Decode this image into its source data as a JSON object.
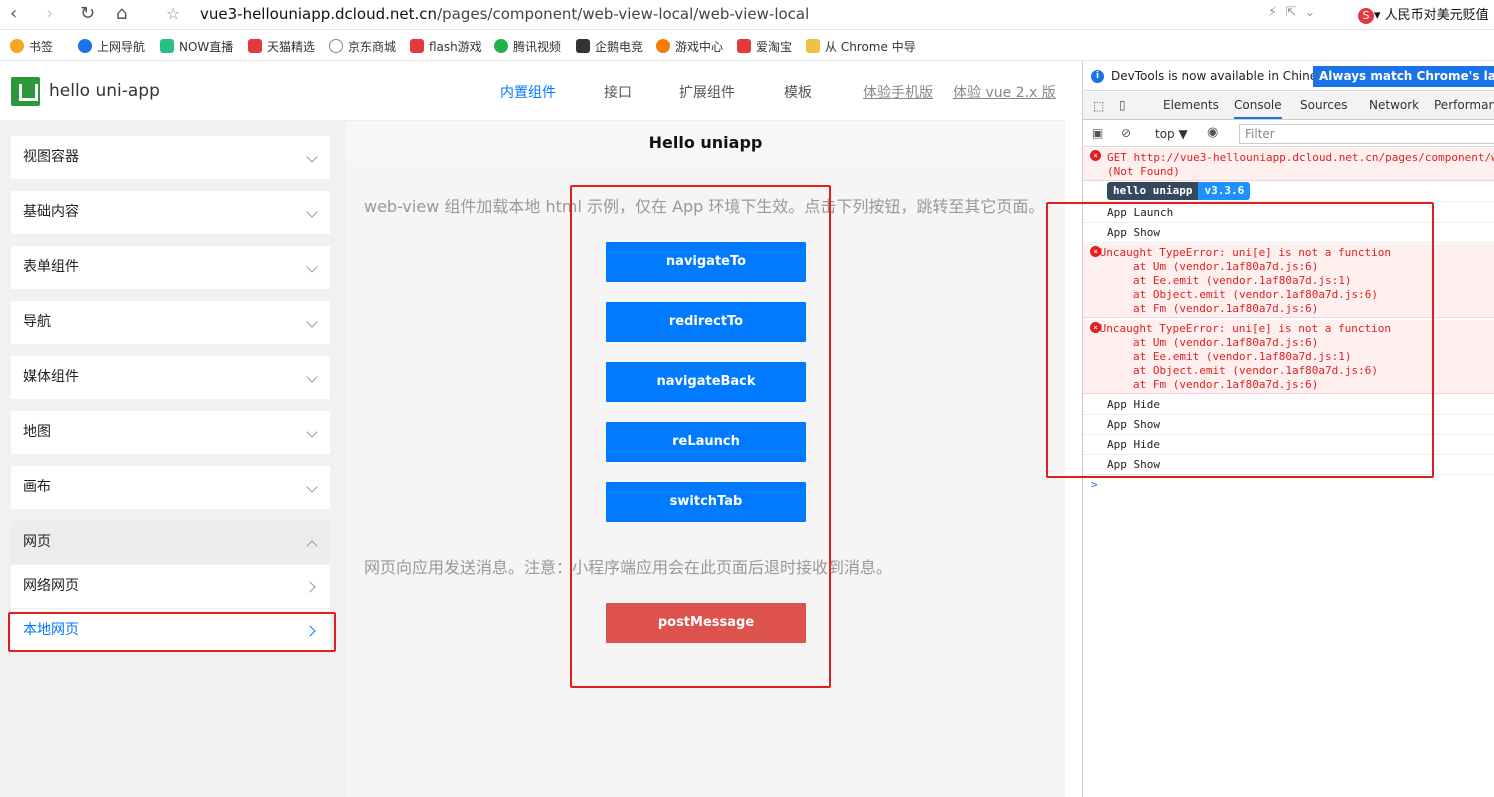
{
  "browser": {
    "url_host": "vue3-hellouniapp.dcloud.net.cn",
    "url_path": "/pages/component/web-view-local/web-view-local",
    "extension_text": "人民币对美元贬值"
  },
  "bookmarks": [
    {
      "label": "书签",
      "color": "#f5a623"
    },
    {
      "label": "上网导航",
      "color": "#1a73e8"
    },
    {
      "label": "NOW直播",
      "color": "#25c286"
    },
    {
      "label": "天猫精选",
      "color": "#e4393c"
    },
    {
      "label": "京东商城",
      "color": "#888888"
    },
    {
      "label": "flash游戏",
      "color": "#e4393c"
    },
    {
      "label": "腾讯视频",
      "color": "#20b14a"
    },
    {
      "label": "企鹅电竞",
      "color": "#333333"
    },
    {
      "label": "游戏中心",
      "color": "#f57c00"
    },
    {
      "label": "爱淘宝",
      "color": "#e4393c"
    },
    {
      "label": "从 Chrome 中导",
      "color": "#f0c040"
    }
  ],
  "app": {
    "title": "hello uni-app",
    "nav": [
      "内置组件",
      "接口",
      "扩展组件",
      "模板",
      "体验手机版",
      "体验 vue 2.x 版"
    ]
  },
  "sidebar": {
    "items": [
      "视图容器",
      "基础内容",
      "表单组件",
      "导航",
      "媒体组件",
      "地图",
      "画布",
      "网页"
    ],
    "subitems": [
      "网络网页",
      "本地网页"
    ]
  },
  "page": {
    "title": "Hello uniapp",
    "desc1": "web-view 组件加载本地 html 示例，仅在 App 环境下生效。点击下列按钮，跳转至其它页面。",
    "buttons": [
      "navigateTo",
      "redirectTo",
      "navigateBack",
      "reLaunch",
      "switchTab"
    ],
    "desc2": "网页向应用发送消息。注意：小程序端应用会在此页面后退时接收到消息。",
    "post_button": "postMessage"
  },
  "devtools": {
    "info_text": "DevTools is now available in Chinese!",
    "info_button": "Always match Chrome's language",
    "tabs": [
      "Elements",
      "Console",
      "Sources",
      "Network",
      "Performance"
    ],
    "context": "top ▼",
    "filter_placeholder": "Filter",
    "get_line1": "GET http://vue3-hellouniapp.dcloud.net.cn/pages/component/w",
    "get_line2": "(Not Found)",
    "badge_name": "hello uniapp",
    "badge_version": "v3.3.6",
    "log_launch": "App Launch",
    "log_show": "App Show",
    "error_title": "▸Uncaught TypeError: uni[e] is not a function",
    "stack": [
      "at Um (vendor.1af80a7d.js:6)",
      "at Ee.emit (vendor.1af80a7d.js:1)",
      "at Object.emit (vendor.1af80a7d.js:6)",
      "at Fm (vendor.1af80a7d.js:6)"
    ],
    "tail": [
      "App Hide",
      "App Show",
      "App Hide",
      "App Show"
    ],
    "prompt": ">"
  }
}
